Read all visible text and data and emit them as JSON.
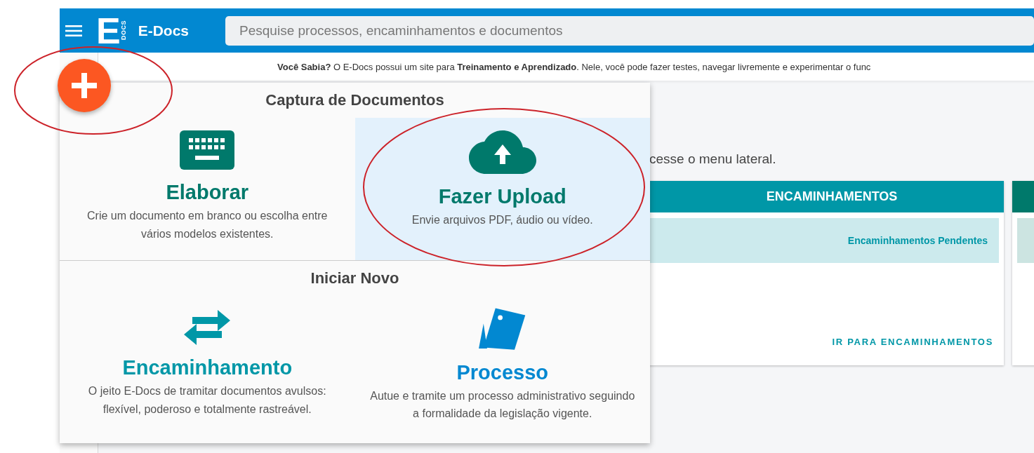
{
  "header": {
    "logo": {
      "letter": "E",
      "sub": "DOCS"
    },
    "app_name": "E-Docs",
    "search": {
      "placeholder": "Pesquise processos, encaminhamentos e documentos"
    }
  },
  "info": "**Você Sabia?** O E-Docs possui um site para **Treinamento e Aprendizado**. Nele, você pode fazer testes, navegar livremente e experimentar o func",
  "content": {
    "intro": "cesse o menu lateral.",
    "cards": [
      {
        "title": "ENCAMINHAMENTOS",
        "band": "Encaminhamentos Pendentes",
        "link": "IR PARA ENCAMINHAMENTOS",
        "color": "#0097a7"
      },
      {
        "color": "#00796b"
      }
    ]
  },
  "popup": {
    "sections": [
      {
        "title": "Captura de Documentos",
        "options": [
          {
            "kind": "keyboard",
            "title": "Elaborar",
            "description": "Crie um documento em branco ou escolha entre vários modelos existentes.",
            "color": "#00796b",
            "selected": false
          },
          {
            "kind": "upload",
            "title": "Fazer Upload",
            "description": "Envie arquivos PDF, áudio ou vídeo.",
            "color": "#00796b",
            "selected": true
          }
        ]
      },
      {
        "title": "Iniciar Novo",
        "options": [
          {
            "kind": "arrows",
            "title": "Encaminhamento",
            "description": "O jeito E-Docs de tramitar documentos avulsos: flexível, poderoso e totalmente rastreável.",
            "color": "#0097a7",
            "selected": false
          },
          {
            "kind": "cards",
            "title": "Processo",
            "description": "Autue e tramite um processo administrativo seguindo a formalidade da legislação vigente.",
            "color": "#0288d1",
            "selected": false
          }
        ]
      }
    ]
  }
}
